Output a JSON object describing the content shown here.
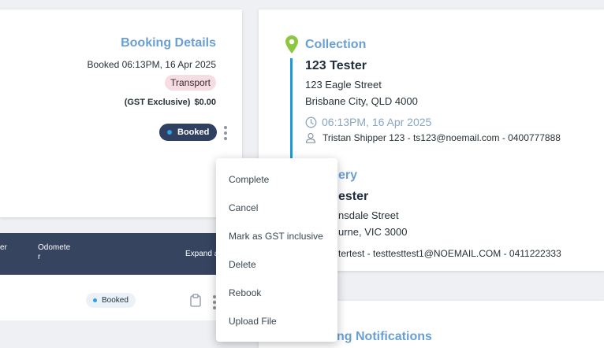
{
  "booking": {
    "title": "Booking Details",
    "booked_time": "Booked 06:13PM, 16 Apr 2025",
    "service_badge": "Transport",
    "price_label": "(GST Exclusive)",
    "price": "$0.00",
    "status": "Booked"
  },
  "table": {
    "headers": {
      "col1_fragment": "er",
      "odometer_line1": "Odomete",
      "odometer_line2": "r",
      "expand": "Expand a"
    },
    "row": {
      "status": "Booked"
    }
  },
  "collection": {
    "title": "Collection",
    "name": "123 Tester",
    "address_line1": "123 Eagle Street",
    "address_line2": "Brisbane City, QLD 4000",
    "time": "06:13PM, 16 Apr 2025",
    "contact": "Tristan Shipper 123 - ts123@noemail.com - 0400777888"
  },
  "delivery": {
    "title_fragment": "ery",
    "name_fragment": "ester",
    "address_line1_fragment": "nsdale Street",
    "address_line2_fragment": "urne, VIC 3000",
    "contact_fragment": "tertest - testtesttest1@NOEMAIL.COM - 0411222333"
  },
  "notifications": {
    "title_fragment": "ng Notifications"
  },
  "menu": {
    "items": [
      "Complete",
      "Cancel",
      "Mark as GST inclusive",
      "Delete",
      "Rebook",
      "Upload File"
    ]
  },
  "colors": {
    "accent_blue": "#6a9fd4",
    "timeline": "#1a9bd7",
    "pin_green": "#8dc63f",
    "navy": "#2f4060",
    "badge_pink": "#f6dce3"
  }
}
